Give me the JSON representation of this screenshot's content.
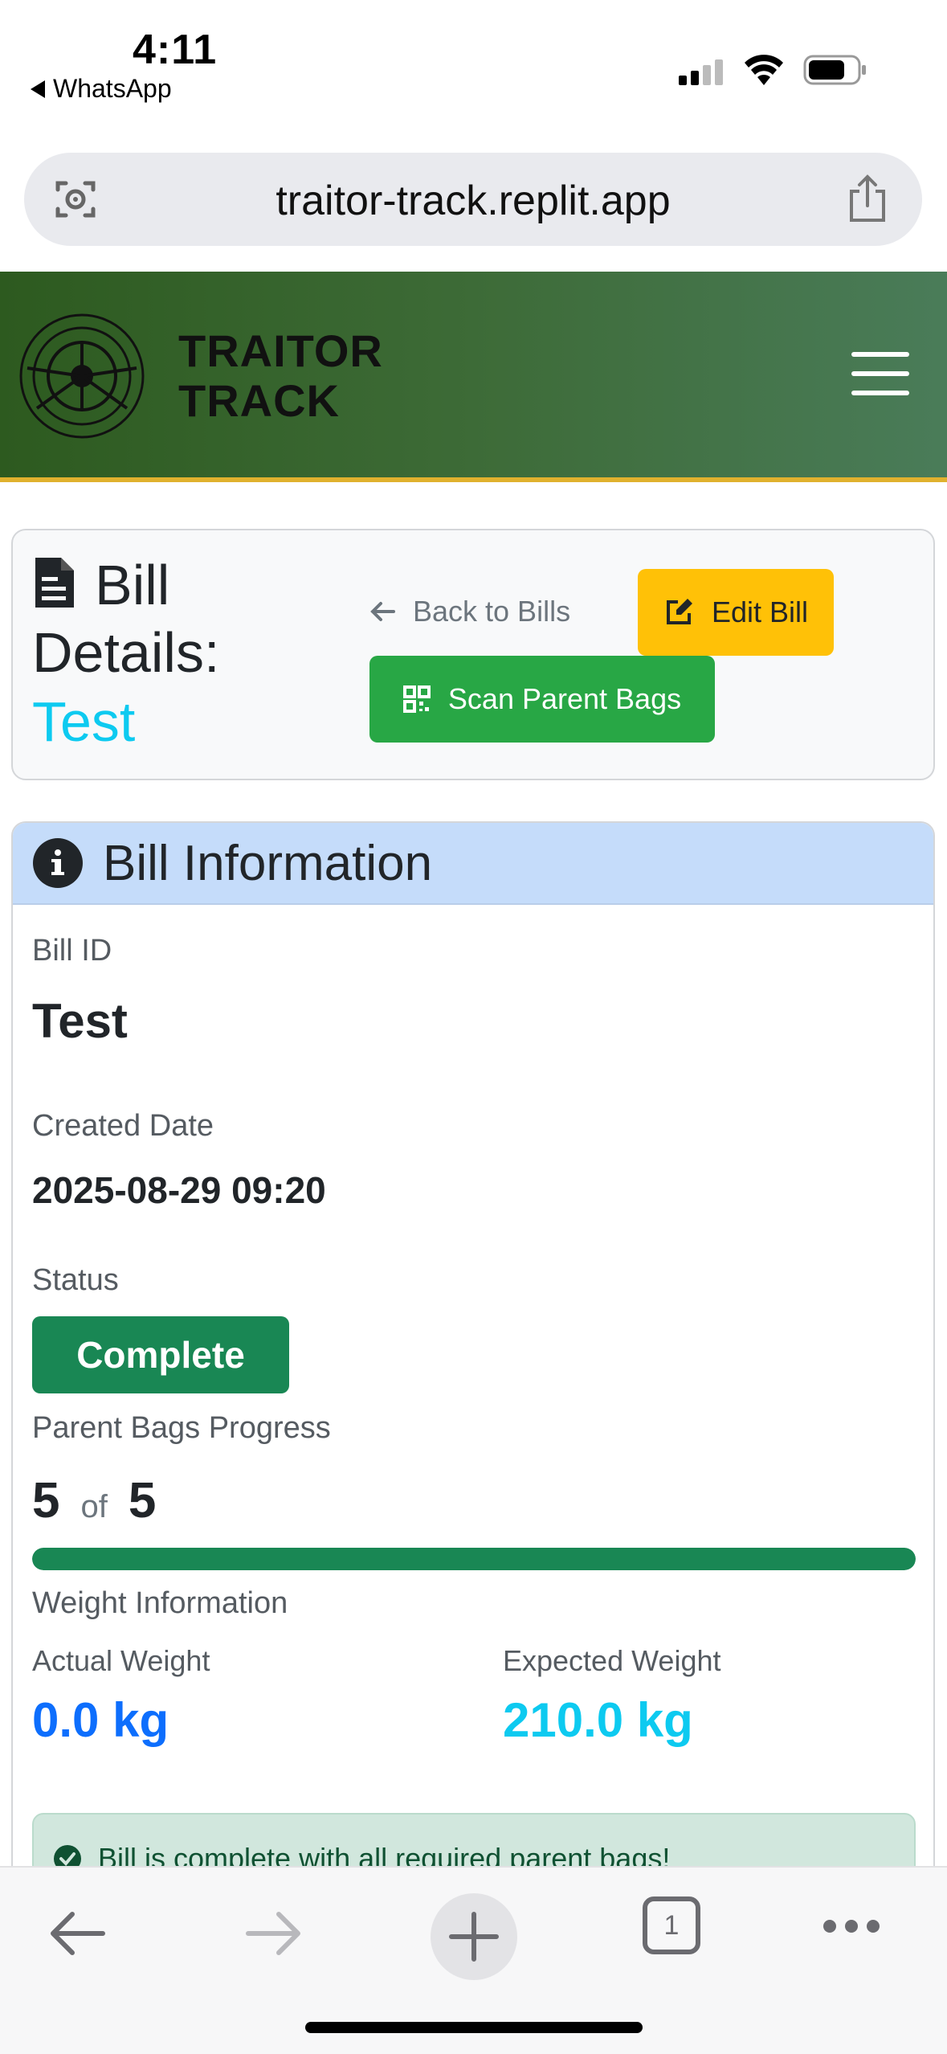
{
  "status_bar": {
    "time": "4:11",
    "back_app": "WhatsApp",
    "icons": [
      "signal-icon",
      "wifi-icon",
      "battery-icon"
    ]
  },
  "browser": {
    "url": "traitor-track.replit.app",
    "left_icon": "camera-search-icon",
    "right_icon": "share-icon"
  },
  "header": {
    "brand_line1": "TRAITOR",
    "brand_line2": "TRACK",
    "menu_icon": "hamburger-menu-icon",
    "colors": {
      "gradient_start": "#2d5a1f",
      "gradient_end": "#4a7c59",
      "accent_border": "#e0b12e"
    }
  },
  "title_card": {
    "title_line1": "Bill",
    "title_line2": "Details:",
    "title_line3": "Test",
    "back_link": "Back to Bills",
    "edit_button": "Edit Bill",
    "scan_button": "Scan Parent Bags"
  },
  "info": {
    "header": "Bill Information",
    "bill_id_label": "Bill ID",
    "bill_id": "Test",
    "created_label": "Created Date",
    "created": "2025-08-29 09:20",
    "status_label": "Status",
    "status": "Complete",
    "progress_label": "Parent Bags Progress",
    "progress_current": "5",
    "progress_of": "of",
    "progress_total": "5",
    "progress_fraction": 1.0,
    "weight_label": "Weight Information",
    "actual_weight_label": "Actual Weight",
    "actual_weight": "0.0 kg",
    "expected_weight_label": "Expected Weight",
    "expected_weight": "210.0 kg",
    "alert_text": "Bill is complete with all required parent bags!"
  },
  "toolbar": {
    "tab_count": "1",
    "icons": [
      "back-arrow-icon",
      "forward-arrow-icon",
      "new-tab-plus-icon",
      "tabs-icon",
      "more-icon"
    ]
  },
  "colors": {
    "status_complete": "#198754",
    "edit_button": "#ffc107",
    "scan_button": "#28a745",
    "actual_weight": "#0d6efd",
    "expected_weight": "#0dcaf0",
    "title_accent": "#0dcaf0"
  }
}
